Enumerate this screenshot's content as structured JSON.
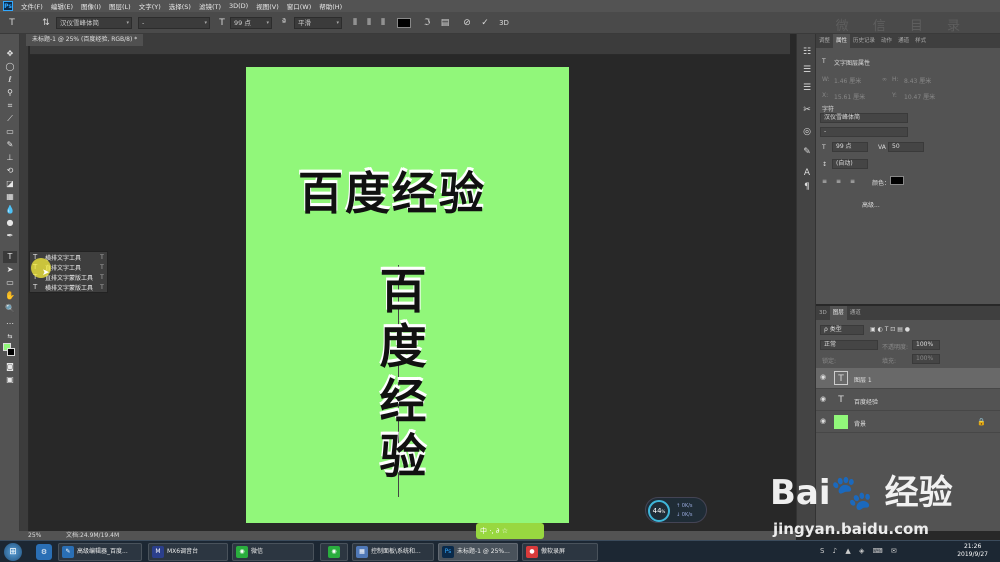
{
  "menubar": {
    "logo": "Ps",
    "items": [
      "文件(F)",
      "编辑(E)",
      "图像(I)",
      "图层(L)",
      "文字(Y)",
      "选择(S)",
      "滤镜(T)",
      "3D(D)",
      "视图(V)",
      "窗口(W)",
      "帮助(H)"
    ]
  },
  "options": {
    "font_family": "汉仪雪峰体简",
    "font_style": "-",
    "font_size": "99 点",
    "antialias": "平滑",
    "watermark": "微 信 目 录"
  },
  "document": {
    "tab_title": "未标题-1 @ 25% (百度经验, RGB/8) *"
  },
  "canvas": {
    "horizontal_text": "百度经验",
    "vertical_text": [
      "百",
      "度",
      "经",
      "验"
    ]
  },
  "flyout": {
    "items": [
      {
        "icon": "T",
        "label": "横排文字工具",
        "key": "T"
      },
      {
        "icon": "T",
        "label": "直排文字工具",
        "key": "T"
      },
      {
        "icon": "T",
        "label": "直排文字蒙版工具",
        "key": "T"
      },
      {
        "icon": "T",
        "label": "横排文字蒙版工具",
        "key": "T"
      }
    ]
  },
  "properties": {
    "tabs": [
      "调整",
      "属性",
      "历史记录",
      "动作",
      "通道",
      "样式"
    ],
    "active_tab": "属性",
    "header": "文字图层属性",
    "w_label": "W:",
    "w_val": "1.46 厘米",
    "h_label": "H:",
    "h_val": "8.43 厘米",
    "x_label": "X:",
    "x_val": "15.61 厘米",
    "y_label": "Y:",
    "y_val": "10.47 厘米",
    "char_title": "字符",
    "font_family": "汉仪雪峰体简",
    "font_style": "-",
    "font_size": "99 点",
    "tracking": "50",
    "leading": "(自动)",
    "color_label": "颜色：",
    "advanced": "高级..."
  },
  "layers": {
    "tabs": [
      "3D",
      "图层",
      "通道"
    ],
    "active_tab": "图层",
    "filter": "ρ 类型",
    "blend": "正常",
    "opacity_label": "不透明度:",
    "opacity_val": "100%",
    "lock_label": "锁定:",
    "fill_label": "填充:",
    "fill_val": "100%",
    "rows": [
      {
        "name": "图层 1",
        "type": "text"
      },
      {
        "name": "百度经验",
        "type": "text"
      },
      {
        "name": "背景",
        "type": "fill"
      }
    ]
  },
  "status": {
    "zoom": "25%",
    "doc": "文档:24.9M/19.4M"
  },
  "speed": {
    "percent": "44",
    "unit": "%",
    "up": "0K/s",
    "down": "0K/s"
  },
  "ime": {
    "text": "中 ·, ∂ ☆"
  },
  "baidu": {
    "logo": "Bai🐾 经验",
    "url": "jingyan.baidu.com"
  },
  "taskbar": {
    "items": [
      {
        "label": "高级编辑器_百度...",
        "color": "#2a6fb5"
      },
      {
        "label": "MX6调音台",
        "color": "#2b3f8c"
      },
      {
        "label": "微信",
        "color": "#2aae3e"
      },
      {
        "label": "",
        "color": "#2aae3e"
      },
      {
        "label": "控制面板\\系统和...",
        "color": "#5079b8"
      },
      {
        "label": "未标题-1 @ 25%...",
        "color": "#0a2a4a"
      },
      {
        "label": "傲软录屏",
        "color": "#d93b3b"
      }
    ],
    "time": "21:26",
    "date": "2019/9/27"
  },
  "colors": {
    "canvas_bg": "#91f77a",
    "text_color": "#111111",
    "fg_color": "#91f77a",
    "bg_color": "#000000"
  }
}
